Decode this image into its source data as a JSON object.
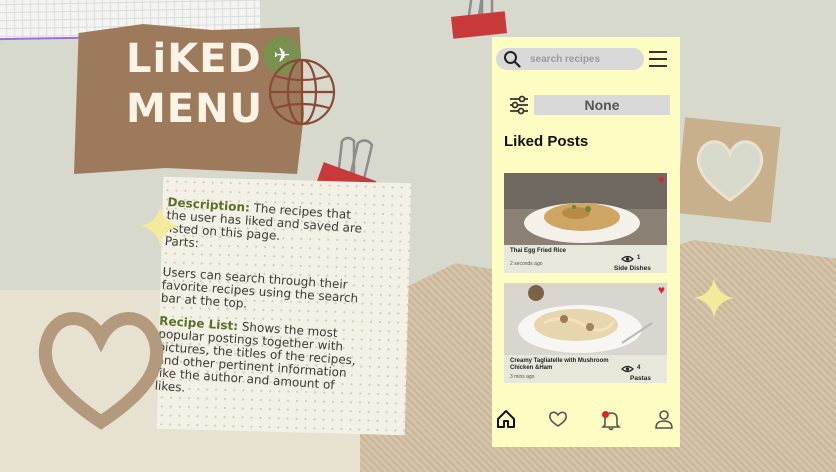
{
  "title": {
    "line1": "LiKED",
    "line2": "MENU"
  },
  "note": {
    "description_label": "Description:",
    "description_text": " The recipes that the user has liked and saved are listed on this page.",
    "parts_label": "Parts:",
    "search_text": "Users can search through their favorite recipes using the search bar at the top.",
    "list_label": "Recipe List:",
    "list_text": " Shows the most popular postings together with pictures, the titles of the recipes, and other pertinent information like the author and amount of likes."
  },
  "phone": {
    "search": {
      "placeholder": "search recipes",
      "icon": "search-icon"
    },
    "menu_icon": "hamburger-icon",
    "filter": {
      "icon": "sliders-icon",
      "value": "None"
    },
    "section_title": "Liked Posts",
    "posts": [
      {
        "title": "Thai Egg Fried Rice",
        "time": "2 seconds ago",
        "views": "1",
        "category": "Side Dishes",
        "liked": true
      },
      {
        "title": "Creamy Tagliatelle with Mushroom Chicken &Ham",
        "time": "3 mins ago",
        "views": "4",
        "category": "Pastas",
        "liked": true
      }
    ],
    "nav": [
      {
        "name": "home",
        "icon": "home-icon",
        "active": true
      },
      {
        "name": "liked",
        "icon": "heart-icon",
        "active": false
      },
      {
        "name": "notifications",
        "icon": "bell-icon",
        "active": false,
        "badge": true
      },
      {
        "name": "profile",
        "icon": "user-icon",
        "active": false
      }
    ]
  },
  "colors": {
    "phone_bg": "#fdfdc3",
    "heart_red": "#e5202a",
    "title_card": "#9e7a5c",
    "note_accent": "#5b6e2a"
  }
}
